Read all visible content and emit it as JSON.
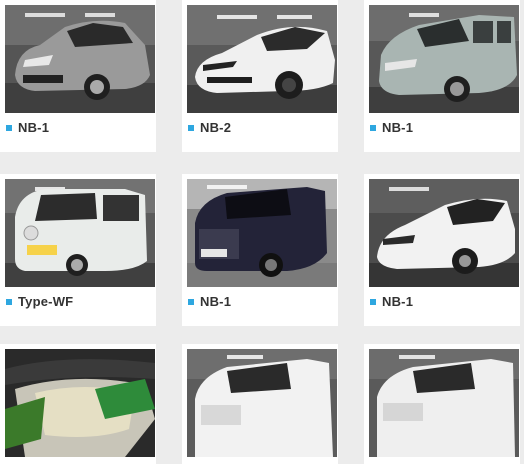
{
  "gallery": {
    "items": [
      {
        "label": "NB-1",
        "car": "silver-hatchback"
      },
      {
        "label": "NB-2",
        "car": "white-sedan"
      },
      {
        "label": "NB-1",
        "car": "grey-minivan"
      },
      {
        "label": "Type-WF",
        "car": "white-kei-van"
      },
      {
        "label": "NB-1",
        "car": "black-minivan"
      },
      {
        "label": "NB-1",
        "car": "white-ev-hatchback"
      },
      {
        "label": "",
        "car": "headlight-closeup"
      },
      {
        "label": "",
        "car": "white-minivan"
      },
      {
        "label": "",
        "car": "white-minivan"
      }
    ]
  },
  "colors": {
    "accent": "#2ea7e0",
    "background": "#ececec",
    "card": "#ffffff"
  }
}
